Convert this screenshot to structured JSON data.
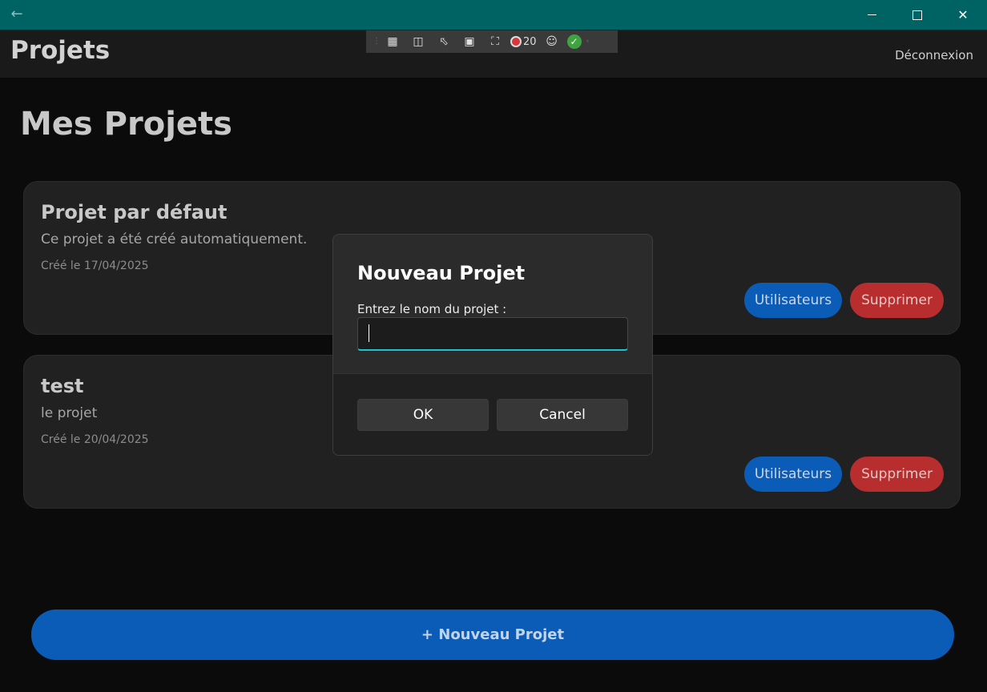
{
  "window": {
    "back_icon": "arrow-left-icon",
    "minimize_icon": "minimize-icon",
    "maximize_icon": "maximize-icon",
    "close_icon": "close-icon",
    "titlebar_color": "#006363"
  },
  "header": {
    "title": "Projets",
    "logout_label": "Déconnexion"
  },
  "devtools": {
    "error_count": "20"
  },
  "main": {
    "page_title": "Mes Projets",
    "projects": [
      {
        "name": "Projet par défaut",
        "description": "Ce projet a été créé automatiquement.",
        "created": "Créé le 17/04/2025",
        "users_label": "Utilisateurs",
        "delete_label": "Supprimer"
      },
      {
        "name": "test",
        "description": "le projet",
        "created": "Créé le 20/04/2025",
        "users_label": "Utilisateurs",
        "delete_label": "Supprimer"
      }
    ],
    "new_project_label": "+ Nouveau Projet"
  },
  "dialog": {
    "title": "Nouveau Projet",
    "prompt": "Entrez le nom du projet :",
    "input_value": "",
    "ok_label": "OK",
    "cancel_label": "Cancel",
    "accent_color": "#19c6cf"
  },
  "colors": {
    "primary_button": "#0b5cb7",
    "danger_button": "#b82e2e"
  }
}
